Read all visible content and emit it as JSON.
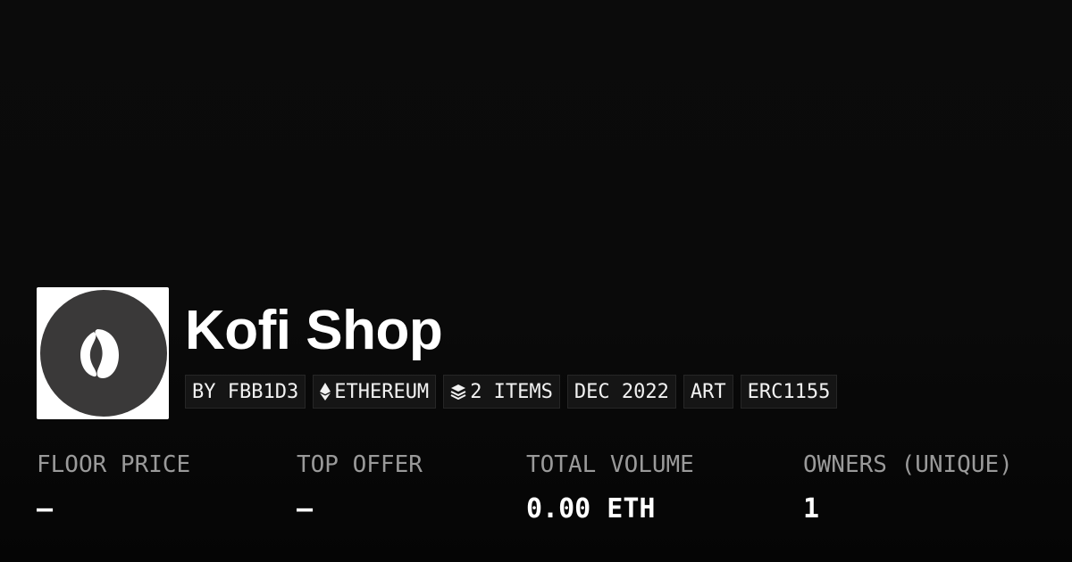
{
  "collection": {
    "name": "Kofi Shop",
    "logo_icon": "coffee-bean-icon",
    "tags": [
      {
        "label": "BY FBB1D3"
      },
      {
        "label": "ETHEREUM",
        "icon": "ethereum-icon"
      },
      {
        "label": "2 ITEMS",
        "icon": "layers-icon"
      },
      {
        "label": "DEC 2022"
      },
      {
        "label": "ART"
      },
      {
        "label": "ERC1155"
      }
    ]
  },
  "stats": [
    {
      "label": "FLOOR PRICE",
      "value": "—"
    },
    {
      "label": "TOP OFFER",
      "value": "—"
    },
    {
      "label": "TOTAL VOLUME",
      "value": "0.00 ETH"
    },
    {
      "label": "OWNERS (UNIQUE)",
      "value": "1"
    }
  ],
  "colors": {
    "background": "#0a0a0a",
    "tag_background": "#151515",
    "label_gray": "#9a9a9a",
    "logo_circle": "#3a3939"
  }
}
